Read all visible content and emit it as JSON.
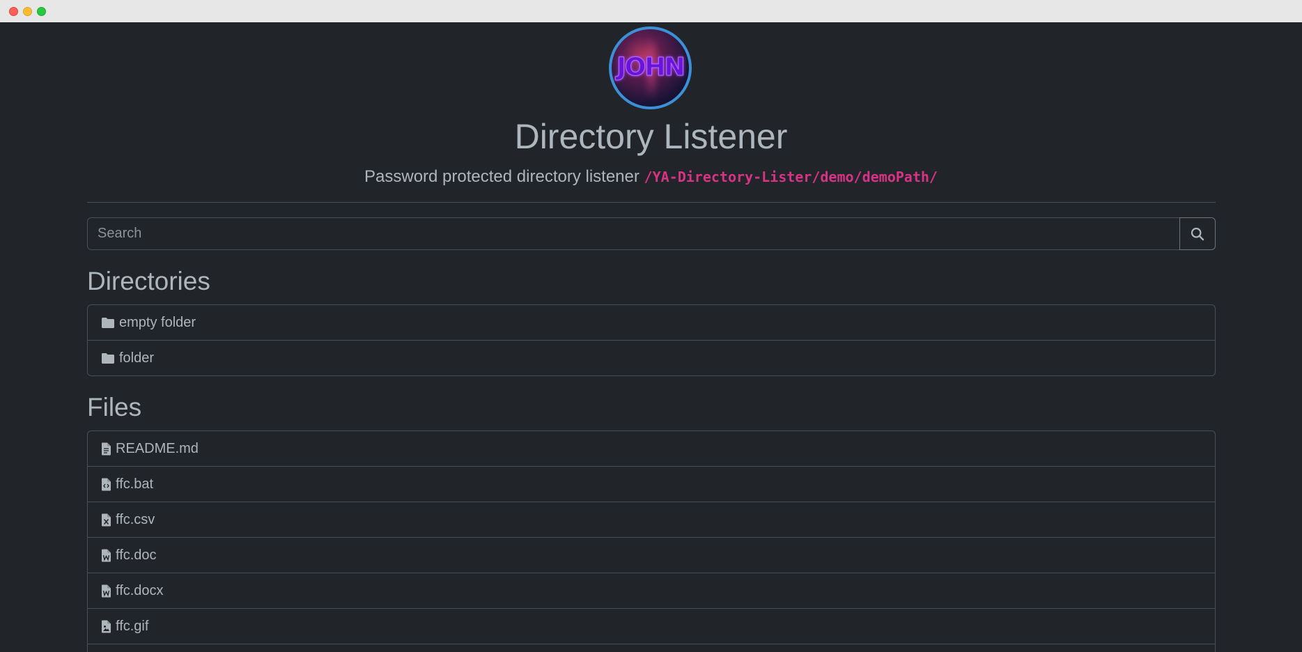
{
  "header": {
    "avatar_text": "JOHN",
    "title": "Directory Listener",
    "subtitle": "Password protected directory listener",
    "path": "/YA-Directory-Lister/demo/demoPath/"
  },
  "search": {
    "placeholder": "Search",
    "value": ""
  },
  "directories": {
    "heading": "Directories",
    "items": [
      {
        "label": "empty folder",
        "icon": "folder-icon"
      },
      {
        "label": "folder",
        "icon": "folder-icon"
      }
    ]
  },
  "files": {
    "heading": "Files",
    "items": [
      {
        "label": "README.md",
        "icon": "file-text-icon"
      },
      {
        "label": "ffc.bat",
        "icon": "file-code-icon"
      },
      {
        "label": "ffc.csv",
        "icon": "file-excel-icon"
      },
      {
        "label": "ffc.doc",
        "icon": "file-word-icon"
      },
      {
        "label": "ffc.docx",
        "icon": "file-word-icon"
      },
      {
        "label": "ffc.gif",
        "icon": "file-image-icon"
      }
    ]
  },
  "colors": {
    "background": "#212529",
    "text": "#adb5bd",
    "border": "#495057",
    "path_accent": "#d63384",
    "avatar_ring": "#3d8fd6"
  }
}
